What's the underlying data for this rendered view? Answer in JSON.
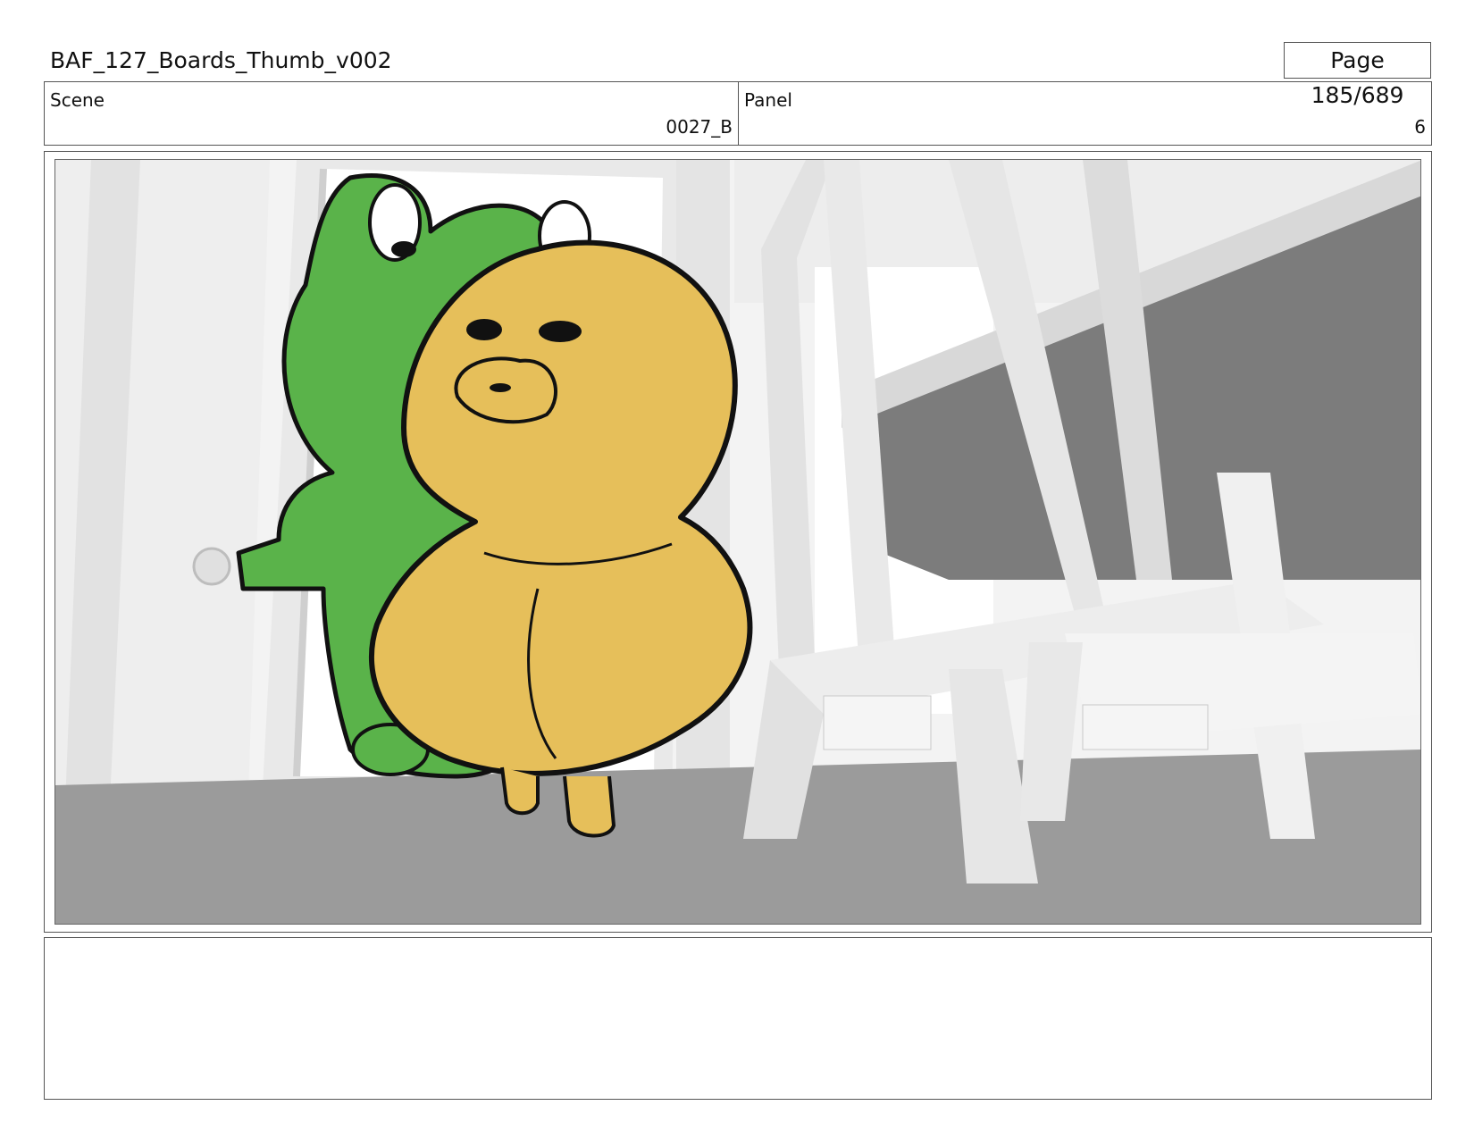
{
  "header": {
    "document_title": "BAF_127_Boards_Thumb_v002",
    "page_label": "Page 185/689"
  },
  "info": {
    "scene_label": "Scene",
    "scene_value": "0027_B",
    "panel_label": "Panel",
    "panel_value": "6"
  },
  "frame": {
    "characters": [
      "green frog character",
      "yellow bear character"
    ],
    "colors": {
      "frog_green": "#5ab34a",
      "bear_yellow": "#e6bf5a",
      "floor_gray": "#9a9a9a",
      "table_gray": "#7c7c7c",
      "wall_white": "#f2f2f2",
      "outline": "#111111"
    }
  },
  "notes": {
    "text": ""
  }
}
